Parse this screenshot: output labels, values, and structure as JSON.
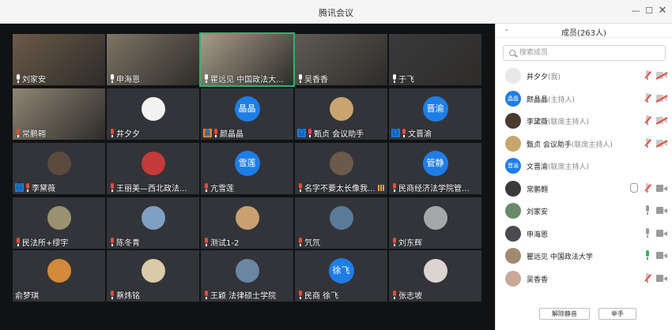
{
  "window": {
    "title": "腾讯会议"
  },
  "tiles": [
    {
      "name": "刘家安",
      "mic": "on",
      "type": "video",
      "bg": "#6a5a48"
    },
    {
      "name": "申海恩",
      "mic": "on",
      "type": "video",
      "bg": "#7d7565"
    },
    {
      "name": "瞿远见 中国政法大...",
      "mic": "on",
      "type": "video",
      "bg": "#a79c8a"
    },
    {
      "name": "吴香香",
      "mic": "on",
      "type": "video",
      "bg": "#5f5a54"
    },
    {
      "name": "于飞",
      "mic": "on",
      "type": "video",
      "bg": "#3a3a3c"
    },
    {
      "name": "常鹏翱",
      "mic": "off",
      "type": "video",
      "bg": "#8f8574"
    },
    {
      "name": "井夕夕",
      "mic": "off",
      "type": "photo",
      "avatar_color": "#f2f2f2"
    },
    {
      "name": "颜晶晶",
      "mic": "off",
      "type": "text",
      "avatar_text": "晶晶",
      "badge": "host-orange"
    },
    {
      "name": "甄贞 会议助手",
      "mic": "off",
      "type": "photo",
      "avatar_color": "#c8a56e",
      "badge": "host"
    },
    {
      "name": "文晋渝",
      "mic": "off",
      "type": "text",
      "avatar_text": "晋渝",
      "badge": "host"
    },
    {
      "name": "李黛薇",
      "mic": "off",
      "type": "photo",
      "avatar_color": "#5a4a40",
      "badge": "host"
    },
    {
      "name": "王丽美—西北政法...",
      "mic": "off",
      "type": "photo",
      "avatar_color": "#c43a3a"
    },
    {
      "name": "亢雪莲",
      "mic": "off",
      "type": "text",
      "avatar_text": "雪莲"
    },
    {
      "name": "名字不要太长像我...",
      "mic": "off",
      "type": "photo",
      "avatar_color": "#6b5a4a",
      "signal": true
    },
    {
      "name": "民商经济法学院管...",
      "mic": "off",
      "type": "text",
      "avatar_text": "管静"
    },
    {
      "name": "民法所+缪宇",
      "mic": "off",
      "type": "photo",
      "avatar_color": "#9a9270"
    },
    {
      "name": "陈冬青",
      "mic": "off",
      "type": "photo",
      "avatar_color": "#7fa0c0"
    },
    {
      "name": "测试1-2",
      "mic": "off",
      "type": "photo",
      "avatar_color": "#c9a070"
    },
    {
      "name": "氕氘",
      "mic": "off",
      "type": "photo",
      "avatar_color": "#5a7a9a"
    },
    {
      "name": "刘东辉",
      "mic": "off",
      "type": "photo",
      "avatar_color": "#a4a8a8"
    },
    {
      "name": "俞梦琪",
      "mic": "none",
      "type": "photo",
      "avatar_color": "#d28a3a"
    },
    {
      "name": "蔡炜铭",
      "mic": "off",
      "type": "photo",
      "avatar_color": "#d9cba8"
    },
    {
      "name": "王颖 法律硕士学院",
      "mic": "off",
      "type": "photo",
      "avatar_color": "#6a86a4"
    },
    {
      "name": "民商 徐飞",
      "mic": "off",
      "type": "text",
      "avatar_text": "徐飞"
    },
    {
      "name": "张志坡",
      "mic": "off",
      "type": "photo",
      "avatar_color": "#dcd4d0"
    }
  ],
  "sidebar": {
    "header": "成员(263人)",
    "search_placeholder": "搜索成员",
    "members": [
      {
        "name": "井夕夕",
        "role": "(我)",
        "avatar": "photo",
        "avatar_color": "#e8e8e8",
        "mic": "off",
        "cam": "off"
      },
      {
        "name": "颜晶晶",
        "role": "(主持人)",
        "avatar": "text",
        "avatar_text": "晶晶",
        "mic": "off",
        "cam": "off"
      },
      {
        "name": "李黛薇",
        "role": "(联席主持人)",
        "avatar": "photo",
        "avatar_color": "#4a3a30",
        "mic": "off",
        "cam": "off"
      },
      {
        "name": "甄贞 会议助手",
        "role": "(联席主持人)",
        "avatar": "photo",
        "avatar_color": "#c8a56e",
        "mic": "off",
        "cam": "off"
      },
      {
        "name": "文晋渝",
        "role": "(联席主持人)",
        "avatar": "text",
        "avatar_text": "晋渝",
        "mic": "none",
        "cam": "none"
      },
      {
        "name": "常鹏翱",
        "role": "",
        "avatar": "photo",
        "avatar_color": "#3a3a3a",
        "mic": "off",
        "cam": "on",
        "hand": true
      },
      {
        "name": "刘家安",
        "role": "",
        "avatar": "photo",
        "avatar_color": "#6a8a6a",
        "mic": "on",
        "cam": "on"
      },
      {
        "name": "申海恩",
        "role": "",
        "avatar": "photo",
        "avatar_color": "#4a4a50",
        "mic": "on",
        "cam": "on"
      },
      {
        "name": "瞿远见 中国政法大学",
        "role": "",
        "avatar": "photo",
        "avatar_color": "#a08a70",
        "mic": "green",
        "cam": "on"
      },
      {
        "name": "吴香香",
        "role": "",
        "avatar": "photo",
        "avatar_color": "#c9a898",
        "mic": "off",
        "cam": "on"
      }
    ],
    "buttons": {
      "unmute": "解除静音",
      "raise": "举手"
    }
  }
}
